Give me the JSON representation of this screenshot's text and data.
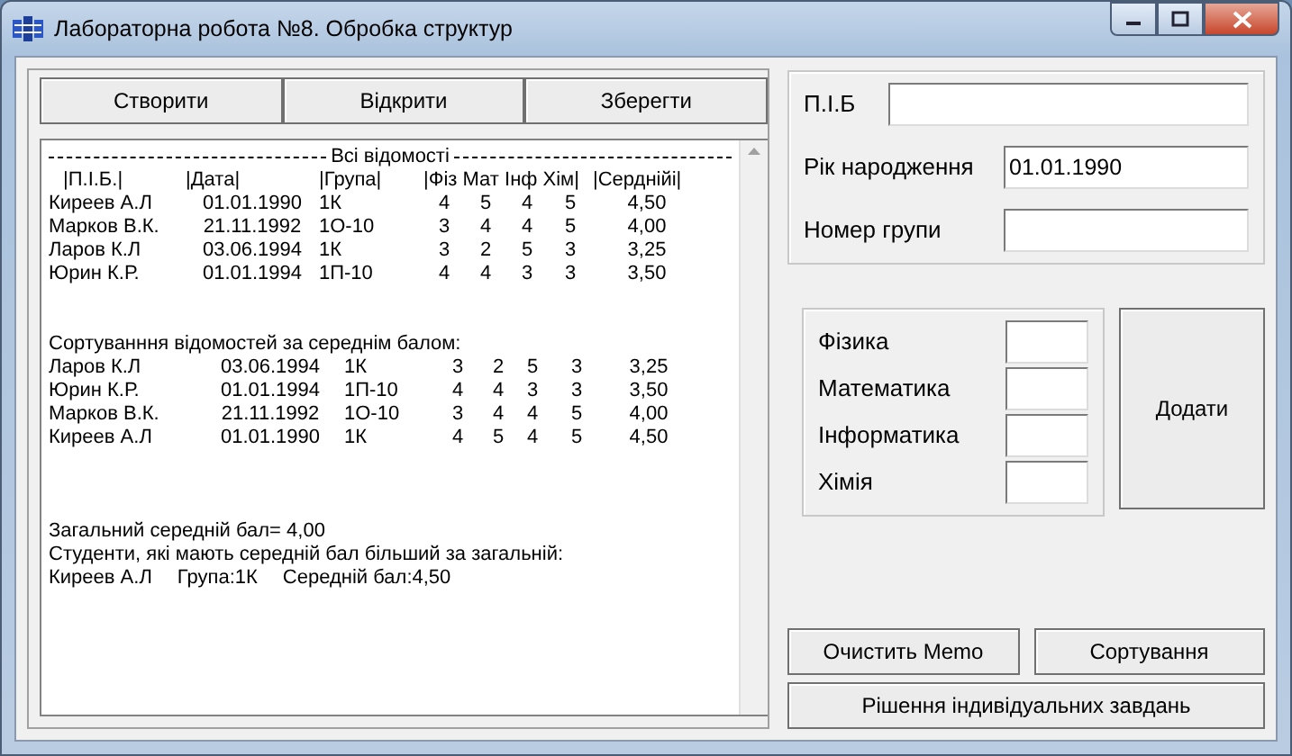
{
  "window": {
    "title": "Лабораторна робота №8. Обробка структур"
  },
  "file_buttons": [
    "Створити",
    "Відкрити",
    "Зберегти"
  ],
  "memo": {
    "heading": "Всі відомості",
    "header_labels": [
      "|П.І.Б.|",
      "|Дата|",
      "|Група|",
      "|Фіз Мат Інф Хім|",
      "|Серднійі|"
    ],
    "rows": [
      {
        "cells": [
          "Киреев А.Л",
          "01.01.1990",
          "1К",
          "4",
          "5",
          "4",
          "5",
          "4,50"
        ]
      },
      {
        "cells": [
          "Марков В.К.",
          "21.11.1992",
          "1О-10",
          "3",
          "4",
          "4",
          "5",
          "4,00"
        ]
      },
      {
        "cells": [
          "Ларов К.Л",
          "03.06.1994",
          "1К",
          "3",
          "2",
          "5",
          "3",
          "3,25"
        ]
      },
      {
        "cells": [
          "Юрин К.Р.",
          "01.01.1994",
          "1П-10",
          "4",
          "4",
          "3",
          "3",
          "3,50"
        ]
      }
    ],
    "sorted_title": "Сортуванння відомостей за середнім балом:",
    "sorted_rows": [
      {
        "cells": [
          "Ларов К.Л",
          "03.06.1994",
          "1К",
          "3",
          "2",
          "5",
          "3",
          "3,25"
        ]
      },
      {
        "cells": [
          "Юрин К.Р.",
          "01.01.1994",
          "1П-10",
          "4",
          "4",
          "3",
          "3",
          "3,50"
        ]
      },
      {
        "cells": [
          "Марков В.К.",
          "21.11.1992",
          "1О-10",
          "3",
          "4",
          "4",
          "5",
          "4,00"
        ]
      },
      {
        "cells": [
          "Киреев А.Л",
          "01.01.1990",
          "1К",
          "4",
          "5",
          "4",
          "5",
          "4,50"
        ]
      }
    ],
    "summary": [
      "Загальний середній бал= 4,00",
      "Студенти, які мають середній бал більший за загальній:"
    ],
    "result": [
      "Киреев А.Л",
      "Група:1К",
      "Середній бал:4,50"
    ]
  },
  "person_fields": [
    {
      "label": "П.І.Б"
    },
    {
      "label": "Рік народження",
      "value": "01.01.1990"
    },
    {
      "label": "Номер групи"
    }
  ],
  "grade_fields": [
    {
      "label": "Фізика"
    },
    {
      "label": "Математика"
    },
    {
      "label": "Інформатика"
    },
    {
      "label": "Хімія"
    }
  ],
  "add_button": "Додати",
  "action_buttons": [
    "Очистить Memo",
    "Сортування"
  ],
  "task_button": "Рішення індивідуальних завдань"
}
